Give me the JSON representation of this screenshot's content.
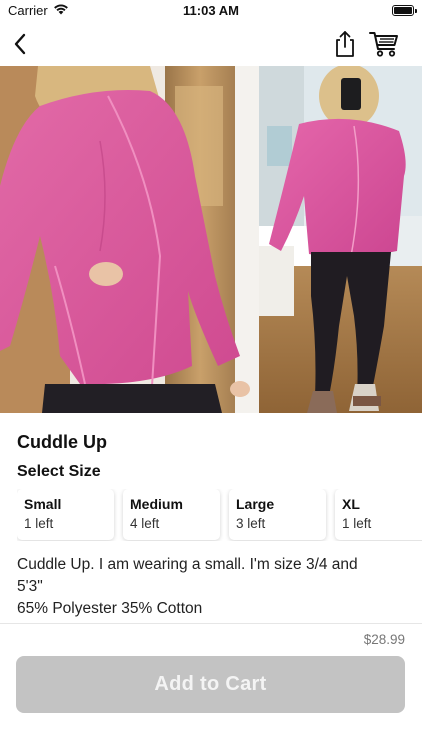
{
  "status_bar": {
    "carrier": "Carrier",
    "time": "11:03 AM"
  },
  "nav": {
    "back_icon": "chevron-left-icon",
    "share_icon": "share-icon",
    "cart_icon": "shopping-cart-icon"
  },
  "product": {
    "title": "Cuddle Up",
    "size_heading": "Select Size",
    "sizes": [
      {
        "name": "Small",
        "stock": "1 left"
      },
      {
        "name": "Medium",
        "stock": "4 left"
      },
      {
        "name": "Large",
        "stock": "3 left"
      },
      {
        "name": "XL",
        "stock": "1 left"
      }
    ],
    "description_lines": [
      "Cuddle Up. I am wearing a small. I'm size 3/4 and",
      "5'3\"",
      "65% Polyester 35% Cotton"
    ],
    "price": "$28.99"
  },
  "actions": {
    "add_to_cart_label": "Add to Cart"
  },
  "colors": {
    "button_disabled": "#c3c3c3",
    "sweatshirt_pink": "#d9559c"
  }
}
